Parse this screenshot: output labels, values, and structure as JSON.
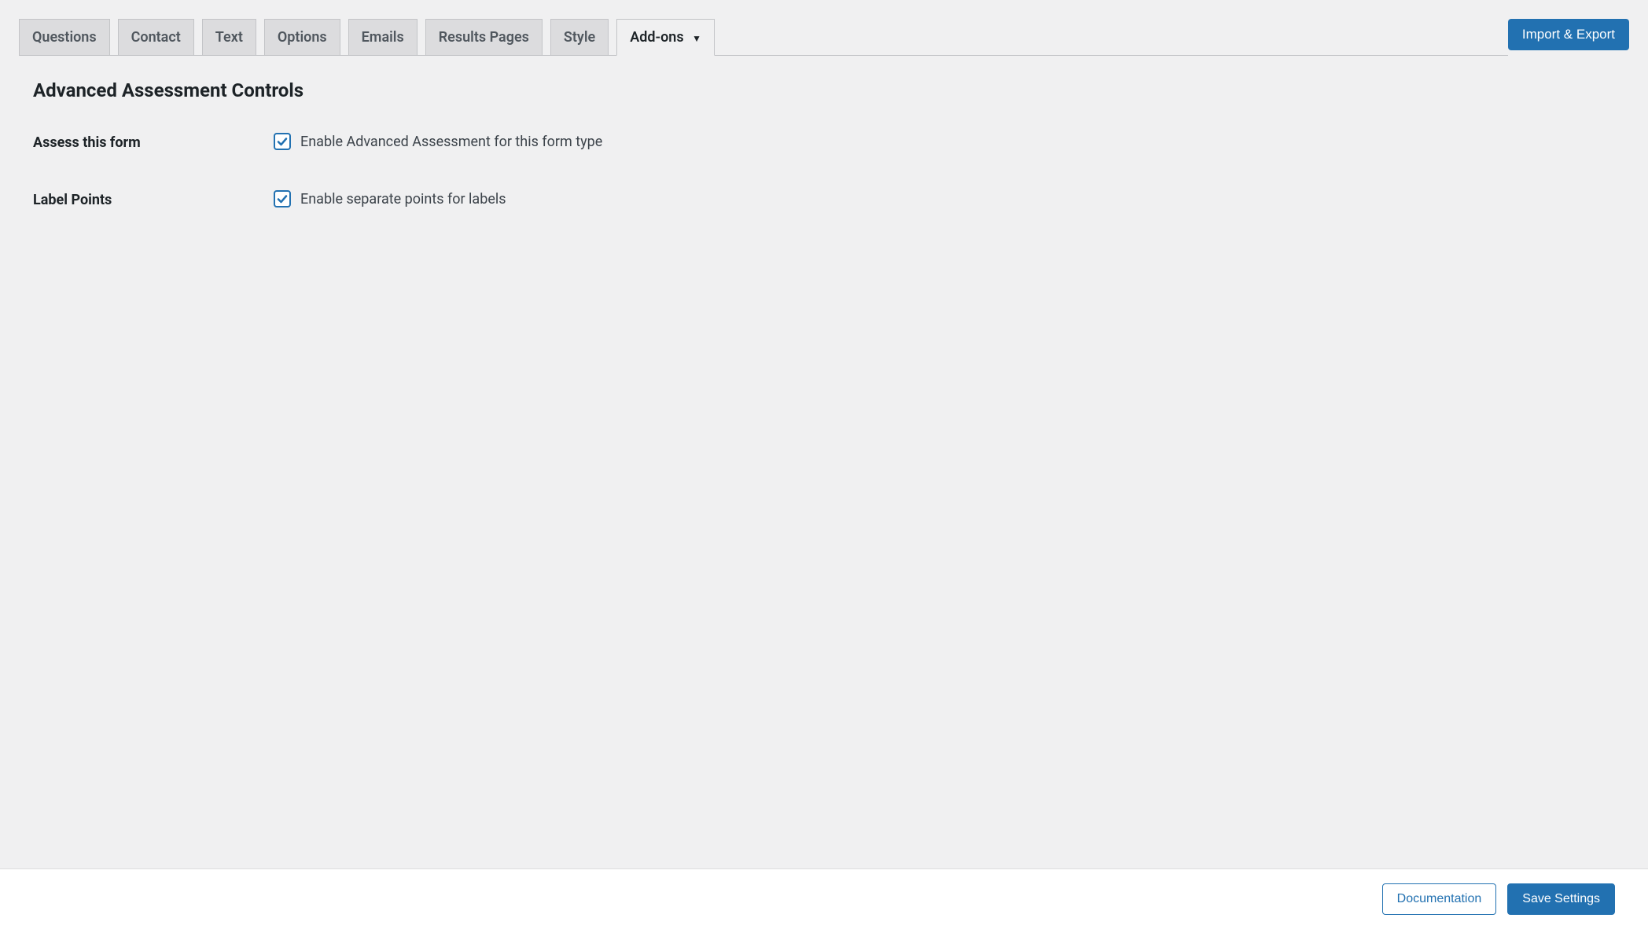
{
  "tabs": {
    "items": [
      {
        "label": "Questions",
        "active": false
      },
      {
        "label": "Contact",
        "active": false
      },
      {
        "label": "Text",
        "active": false
      },
      {
        "label": "Options",
        "active": false
      },
      {
        "label": "Emails",
        "active": false
      },
      {
        "label": "Results Pages",
        "active": false
      },
      {
        "label": "Style",
        "active": false
      },
      {
        "label": "Add-ons",
        "active": true,
        "dropdown": true
      }
    ]
  },
  "header": {
    "import_export_label": "Import & Export"
  },
  "section": {
    "title": "Advanced Assessment Controls"
  },
  "settings": {
    "assess_form": {
      "label": "Assess this form",
      "checkbox_label": "Enable Advanced Assessment for this form type",
      "checked": true
    },
    "label_points": {
      "label": "Label Points",
      "checkbox_label": "Enable separate points for labels",
      "checked": true
    }
  },
  "footer": {
    "documentation_label": "Documentation",
    "save_label": "Save Settings"
  }
}
